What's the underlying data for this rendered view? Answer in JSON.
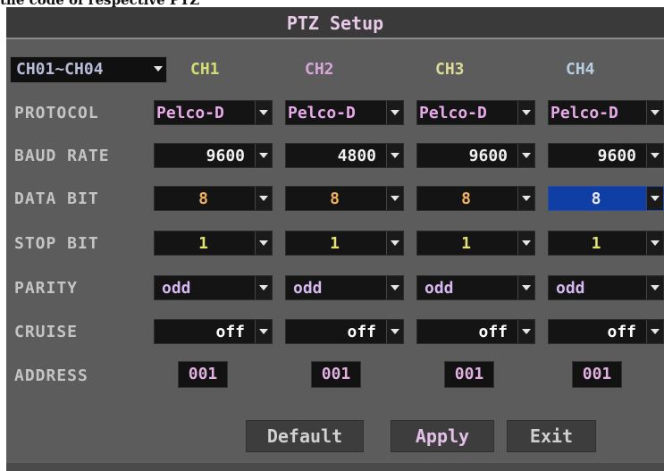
{
  "caption": "the code of respective PTZ",
  "title": "PTZ Setup",
  "channel_range": {
    "value": "CH01~CH04"
  },
  "channels": [
    "CH1",
    "CH2",
    "CH3",
    "CH4"
  ],
  "labels": {
    "protocol": "PROTOCOL",
    "baud_rate": "BAUD RATE",
    "data_bit": "DATA BIT",
    "stop_bit": "STOP BIT",
    "parity": "PARITY",
    "cruise": "CRUISE",
    "address": "ADDRESS"
  },
  "values": {
    "protocol": [
      "Pelco-D",
      "Pelco-D",
      "Pelco-D",
      "Pelco-D"
    ],
    "baud_rate": [
      "9600",
      "4800",
      "9600",
      "9600"
    ],
    "data_bit": [
      "8",
      "8",
      "8",
      "8"
    ],
    "stop_bit": [
      "1",
      "1",
      "1",
      "1"
    ],
    "parity": [
      "odd",
      "odd",
      "odd",
      "odd"
    ],
    "cruise": [
      "off",
      "off",
      "off",
      "off"
    ],
    "address": [
      "001",
      "001",
      "001",
      "001"
    ]
  },
  "buttons": {
    "default": "Default",
    "apply": "Apply",
    "exit": "Exit"
  },
  "colors": {
    "panel_bg": "#5c5c5c",
    "selected_bg": "#0f3fa5",
    "protocol_text": "#e6a8e6",
    "baud_text": "#f0f0f0",
    "data_bit_text": "#f0b060",
    "stop_bit_text": "#e8e070",
    "parity_text": "#d8b8f0",
    "cruise_text": "#ffffff",
    "address_text": "#e0b0e0"
  }
}
